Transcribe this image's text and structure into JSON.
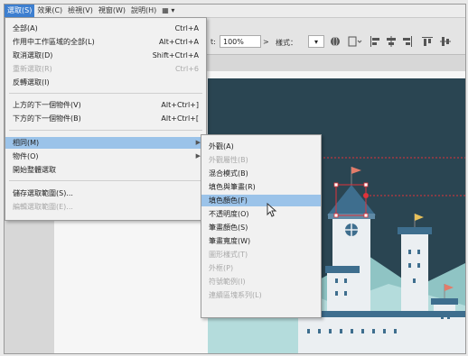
{
  "menubar": {
    "items": [
      "選取(S)",
      "效果(C)",
      "檢視(V)",
      "視窗(W)",
      "說明(H)"
    ],
    "extra_icon": "▦ ▾"
  },
  "toolbar": {
    "opacity_label": "t:",
    "opacity_value": "100%",
    "style_label": "樣式：",
    "style_arrow": "▾"
  },
  "select_menu": {
    "items": [
      {
        "label": "全部(A)",
        "shortcut": "Ctrl+A"
      },
      {
        "label": "作用中工作區域的全部(L)",
        "shortcut": "Alt+Ctrl+A"
      },
      {
        "label": "取消選取(D)",
        "shortcut": "Shift+Ctrl+A"
      },
      {
        "label": "重新選取(R)",
        "shortcut": "Ctrl+6"
      },
      {
        "label": "反轉選取(I)",
        "shortcut": ""
      },
      {
        "label": "上方的下一個物件(V)",
        "shortcut": "Alt+Ctrl+]"
      },
      {
        "label": "下方的下一個物件(B)",
        "shortcut": "Alt+Ctrl+["
      },
      {
        "label": "相同(M)",
        "shortcut": ""
      },
      {
        "label": "物件(O)",
        "shortcut": ""
      },
      {
        "label": "開始整體選取",
        "shortcut": ""
      },
      {
        "label": "儲存選取範圍(S)...",
        "shortcut": ""
      },
      {
        "label": "編輯選取範圍(E)...",
        "shortcut": ""
      }
    ]
  },
  "same_submenu": {
    "items": [
      {
        "label": "外觀(A)"
      },
      {
        "label": "外觀屬性(B)"
      },
      {
        "label": "混合模式(B)"
      },
      {
        "label": "填色與筆畫(R)"
      },
      {
        "label": "填色顏色(F)"
      },
      {
        "label": "不透明度(O)"
      },
      {
        "label": "筆畫顏色(S)"
      },
      {
        "label": "筆畫寬度(W)"
      },
      {
        "label": "圖形樣式(T)"
      },
      {
        "label": "外框(P)"
      },
      {
        "label": "符號範例(I)"
      },
      {
        "label": "連續區塊系列(L)"
      }
    ]
  },
  "colors": {
    "menu_highlight": "#9bc3e9",
    "menubar_active": "#3d7fd0",
    "artboard_bg": "#2a4552",
    "castle_blue": "#3e6e8e",
    "castle_wall": "#ebeff2",
    "flag": "#e27c6a",
    "selection_red": "#e0323a",
    "mountain": "#9ecfcf"
  },
  "icons": [
    "globe-icon",
    "document-icon",
    "align-left-icon",
    "align-center-icon",
    "align-right-icon",
    "align-top-icon",
    "align-middle-icon",
    "cursor-icon"
  ]
}
